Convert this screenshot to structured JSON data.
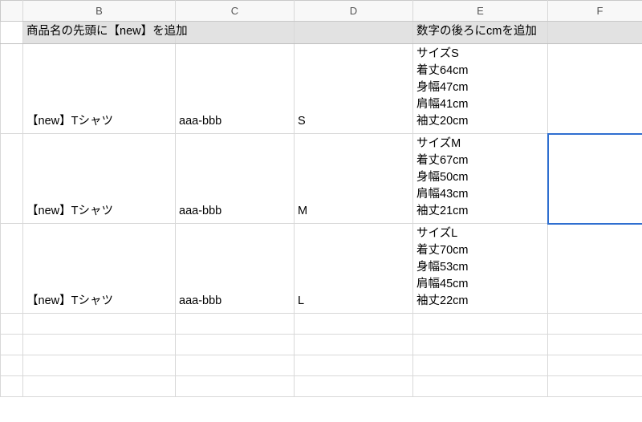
{
  "columns": {
    "stub": "",
    "B": "B",
    "C": "C",
    "D": "D",
    "E": "E",
    "F": "F"
  },
  "header_row": {
    "B": "商品名の先頭に【new】を追加",
    "C": "",
    "D": "",
    "E": "数字の後ろにcmを追加",
    "F": ""
  },
  "rows": [
    {
      "B": "【new】Tシャツ",
      "C": "aaa-bbb",
      "D": "S",
      "E": "サイズS\n着丈64cm\n身幅47cm\n肩幅41cm\n袖丈20cm",
      "F": ""
    },
    {
      "B": "【new】Tシャツ",
      "C": "aaa-bbb",
      "D": "M",
      "E": "サイズM\n着丈67cm\n身幅50cm\n肩幅43cm\n袖丈21cm",
      "F": ""
    },
    {
      "B": "【new】Tシャツ",
      "C": "aaa-bbb",
      "D": "L",
      "E": "サイズL\n着丈70cm\n身幅53cm\n肩幅45cm\n袖丈22cm",
      "F": ""
    }
  ],
  "selection": {
    "col": "F",
    "rowIndex": 1
  }
}
